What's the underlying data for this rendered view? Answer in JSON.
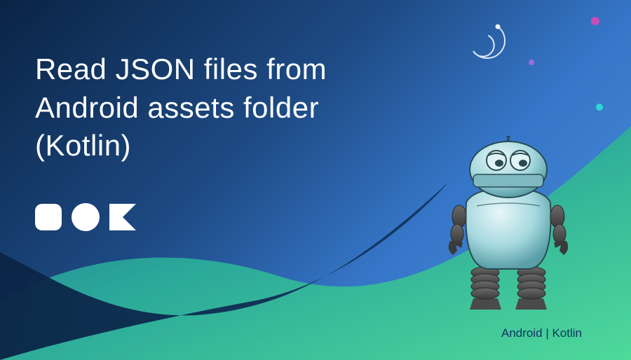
{
  "title_lines": [
    "Read JSON files from",
    "Android assets folder",
    "(Kotlin)"
  ],
  "caption": "Android | Kotlin",
  "icons": {
    "square": "rounded-square-icon",
    "circle": "circle-icon",
    "kotlin": "kotlin-logo-icon"
  },
  "decorations": {
    "swirl": "spiral-swirl-icon",
    "dots": [
      "pink",
      "purple",
      "cyan",
      "blue"
    ]
  },
  "mascot": "android-robot-mascot",
  "colors": {
    "bg_dark": "#0a2445",
    "bg_mid": "#1e4b85",
    "bg_light": "#4a8dd9",
    "wave_green": "#3fcf9a",
    "wave_teal": "#2a9fb5",
    "text": "#ffffff",
    "caption": "#0f3560"
  }
}
